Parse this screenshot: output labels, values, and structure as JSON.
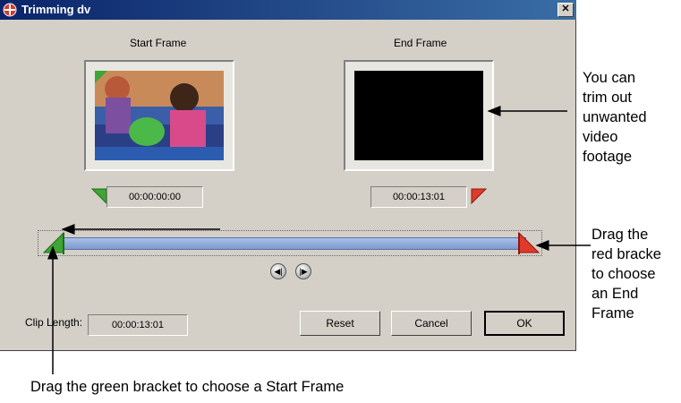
{
  "window": {
    "title": "Trimming dv",
    "close_glyph": "✕"
  },
  "labels": {
    "start_frame": "Start Frame",
    "end_frame": "End Frame",
    "clip_length": "Clip Length:"
  },
  "times": {
    "start": "00:00:00:00",
    "end": "00:00:13:01",
    "clip_length": "00:00:13:01"
  },
  "buttons": {
    "reset": "Reset",
    "cancel": "Cancel",
    "ok": "OK"
  },
  "steppers": {
    "prev_glyph": "◀|",
    "next_glyph": "|▶"
  },
  "callouts": {
    "trim": [
      "You can",
      "trim out",
      "unwanted",
      "video",
      "footage"
    ],
    "red_bracket": [
      "Drag the",
      "red bracke",
      "to choose",
      "an End",
      "Frame"
    ],
    "green_bracket": "Drag the green bracket to choose a Start Frame"
  },
  "colors": {
    "start_marker": "#3fa535",
    "end_marker": "#e03a2a",
    "title_bar": "#0a246a",
    "timeline_bar": "#8fa9db"
  }
}
